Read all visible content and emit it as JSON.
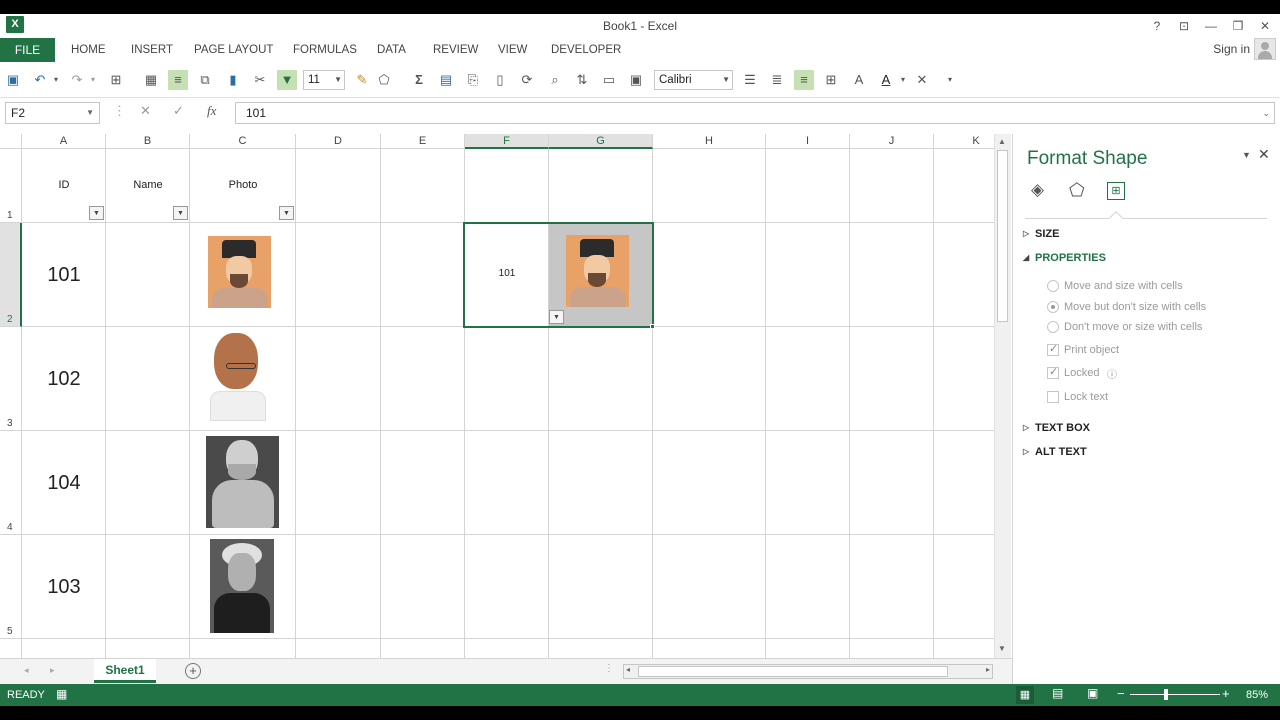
{
  "window": {
    "title": "Book1 - Excel",
    "app_icon": "X"
  },
  "ribbon": {
    "file": "FILE",
    "tabs": [
      "HOME",
      "INSERT",
      "PAGE LAYOUT",
      "FORMULAS",
      "DATA",
      "REVIEW",
      "VIEW",
      "DEVELOPER"
    ],
    "sign_in": "Sign in"
  },
  "toolbar": {
    "font_size": "11",
    "font_name": "Calibri"
  },
  "formula_bar": {
    "name_box": "F2",
    "fx": "fx",
    "value": "101"
  },
  "columns": [
    "A",
    "B",
    "C",
    "D",
    "E",
    "F",
    "G",
    "H",
    "I",
    "J",
    "K"
  ],
  "rows": [
    "1",
    "2",
    "3",
    "4",
    "5"
  ],
  "table": {
    "headers": [
      "ID",
      "Name",
      "Photo"
    ],
    "ids": [
      "101",
      "102",
      "104",
      "103"
    ],
    "lookup_value": "101"
  },
  "sheet_tab": "Sheet1",
  "status": {
    "ready": "READY",
    "zoom": "85%"
  },
  "panel": {
    "title": "Format Shape",
    "sections": {
      "size": "SIZE",
      "properties": "PROPERTIES",
      "text_box": "TEXT BOX",
      "alt_text": "ALT TEXT"
    },
    "options": {
      "move_size": "Move and size with cells",
      "move_no_size": "Move but don't size with cells",
      "no_move": "Don't move or size with cells",
      "print": "Print object",
      "locked": "Locked",
      "lock_text": "Lock text"
    }
  },
  "colors": {
    "accent": "#217346",
    "selection_fill": "#c6c6c6"
  }
}
